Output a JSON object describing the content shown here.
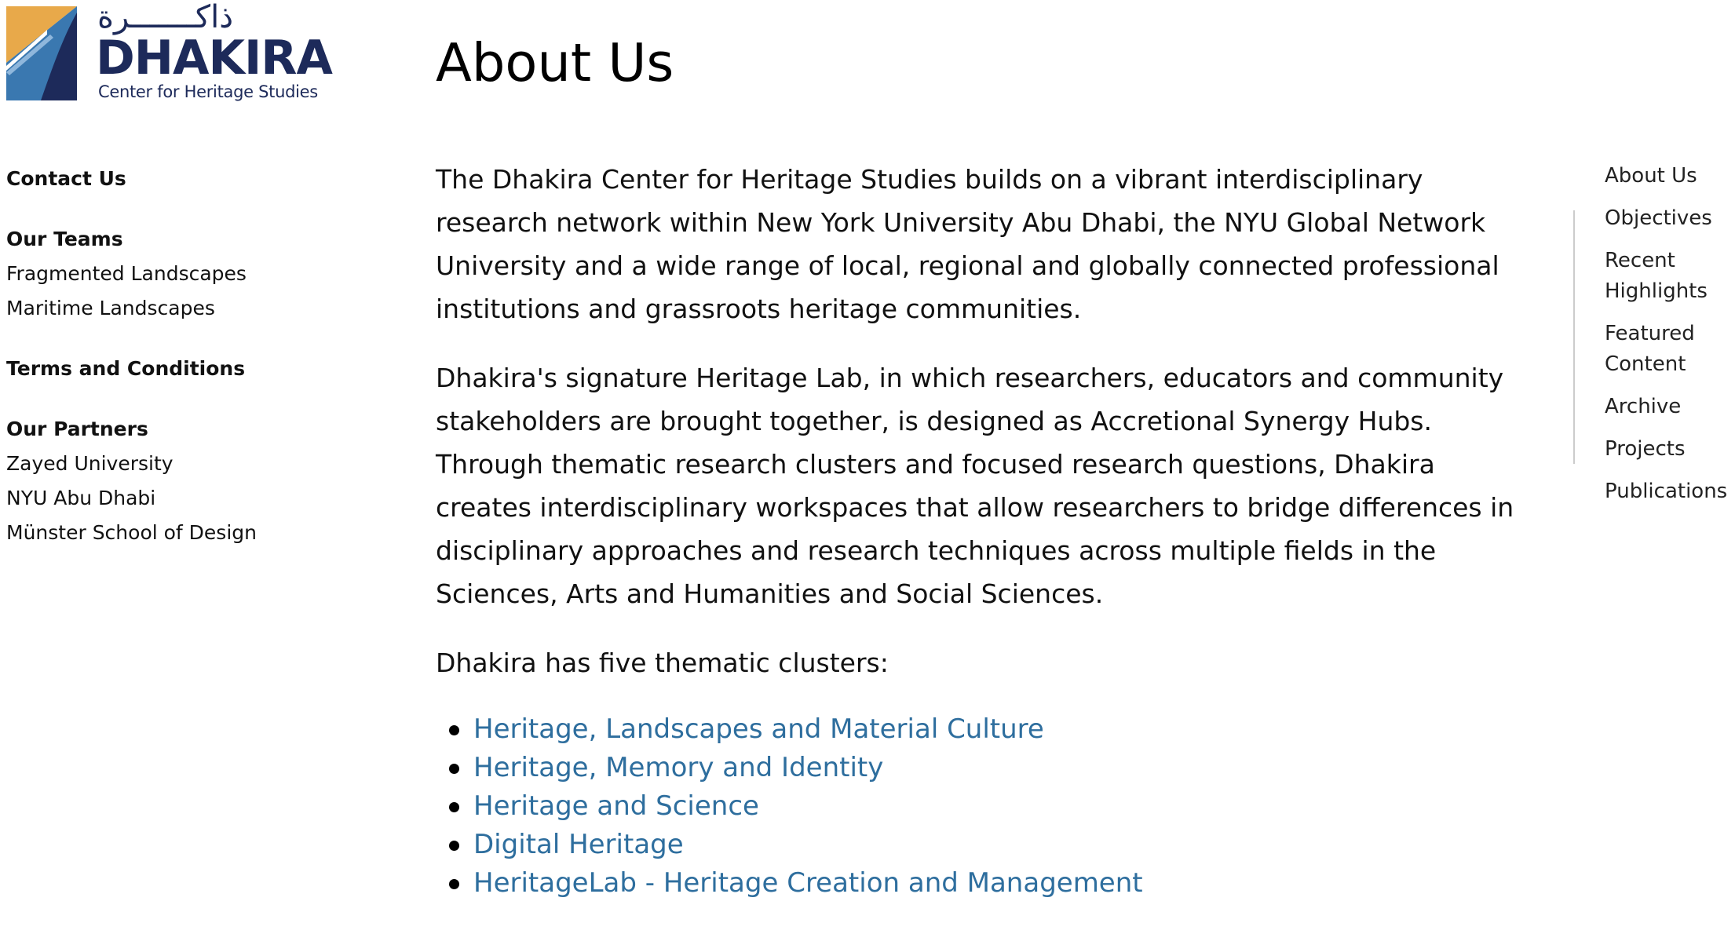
{
  "logo": {
    "arabic_text": "ذاكـــــــرة",
    "name": "DHAKIRA",
    "tagline": "Center for Heritage Studies",
    "colors": {
      "navy": "#1d2a5a",
      "blue": "#3a78b0",
      "light_blue": "#8fb7dc",
      "gold": "#e8a94a"
    }
  },
  "sidebar": {
    "contact_label": "Contact Us",
    "teams": {
      "heading": "Our Teams",
      "items": [
        "Fragmented Landscapes",
        "Maritime Landscapes"
      ]
    },
    "terms_label": "Terms and Conditions",
    "partners": {
      "heading": "Our Partners",
      "items": [
        "Zayed University",
        "NYU Abu Dhabi",
        "Münster School of Design"
      ]
    }
  },
  "main": {
    "title": "About Us",
    "paragraphs": [
      "The Dhakira Center for Heritage Studies builds on a vibrant interdisciplinary research network within New York University Abu Dhabi, the NYU Global Network University and a wide range of local, regional and globally connected professional institutions and grassroots heritage communities.",
      "Dhakira's signature Heritage Lab, in which researchers, educators and community stakeholders are brought together, is designed as Accretional Synergy Hubs. Through thematic research clusters and focused research questions, Dhakira creates interdisciplinary workspaces that allow researchers to bridge differences in disciplinary approaches and research techniques across multiple fields in the Sciences, Arts and Humanities and Social Sciences.",
      "Dhakira has five thematic clusters:"
    ],
    "clusters": [
      "Heritage, Landscapes and Material Culture",
      "Heritage, Memory and Identity",
      "Heritage and Science",
      "Digital Heritage",
      "HeritageLab - Heritage Creation and Management"
    ],
    "link_color": "#2e6e9e"
  },
  "toc": {
    "items": [
      "About Us",
      "Objectives",
      "Recent Highlights",
      "Featured Content",
      "Archive",
      "Projects",
      "Publications"
    ]
  }
}
